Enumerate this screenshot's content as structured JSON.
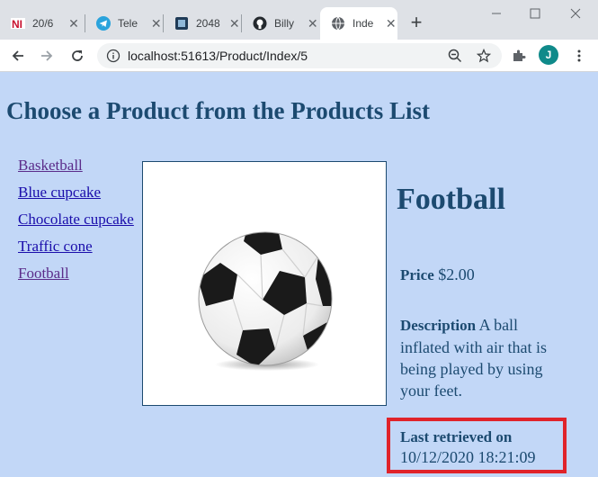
{
  "browser": {
    "tabs": [
      {
        "title": "20/6",
        "icon": "ni-logo-icon"
      },
      {
        "title": "Tele",
        "icon": "telegram-icon"
      },
      {
        "title": "2048",
        "icon": "app-icon"
      },
      {
        "title": "Billy",
        "icon": "github-icon"
      },
      {
        "title": "Inde",
        "icon": "globe-icon",
        "active": true
      }
    ],
    "url": "localhost:51613/Product/Index/5",
    "profile_initial": "J"
  },
  "page": {
    "title": "Choose a Product from the Products List",
    "nav": [
      {
        "label": "Basketball",
        "visited": true
      },
      {
        "label": "Blue cupcake",
        "visited": false
      },
      {
        "label": "Chocolate cupcake",
        "visited": false
      },
      {
        "label": "Traffic cone",
        "visited": false
      },
      {
        "label": "Football",
        "visited": true
      }
    ],
    "product": {
      "name": "Football",
      "price_label": "Price",
      "price": "$2.00",
      "description_label": "Description",
      "description": "A ball inflated with air that is being played by using your feet.",
      "last_retrieved_label": "Last retrieved on",
      "last_retrieved": "10/12/2020 18:21:09"
    }
  },
  "colors": {
    "page_bg": "#c2d7f7",
    "heading": "#1c4a70",
    "highlight_border": "#e0232a"
  }
}
